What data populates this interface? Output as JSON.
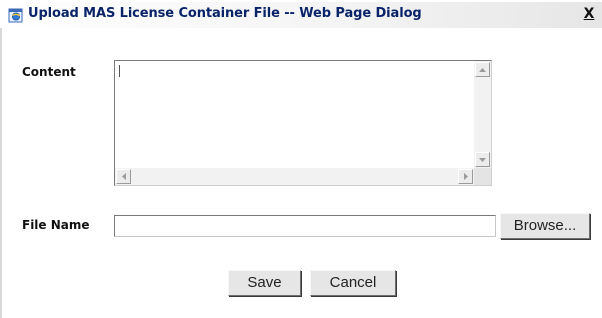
{
  "dialog": {
    "title": "Upload MAS License Container File -- Web Page Dialog",
    "close_label": "X"
  },
  "form": {
    "content_label": "Content",
    "content_value": "",
    "file_name_label": "File Name",
    "file_name_value": "",
    "browse_label": "Browse..."
  },
  "actions": {
    "save_label": "Save",
    "cancel_label": "Cancel"
  },
  "icons": {
    "title_icon": "ie-page-icon",
    "scroll_up": "arrow-up-icon",
    "scroll_down": "arrow-down-icon",
    "scroll_left": "arrow-left-icon",
    "scroll_right": "arrow-right-icon"
  },
  "colors": {
    "title_text": "#0a246a",
    "button_face": "#e6e6e6",
    "scrollbar_track": "#f2f2f2"
  }
}
